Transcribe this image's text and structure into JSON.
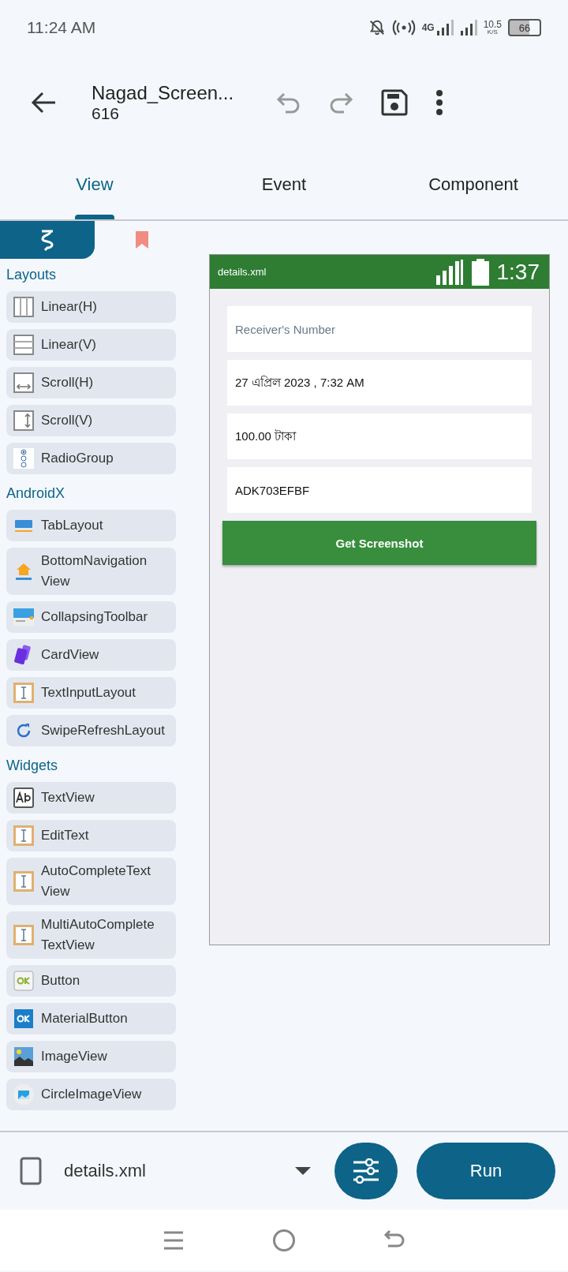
{
  "status_bar": {
    "time": "11:24 AM",
    "network": "4G",
    "speed": "10.5",
    "speed_unit": "K/S",
    "battery": "66"
  },
  "toolbar": {
    "title": "Nagad_Screen...",
    "subtitle": "616"
  },
  "tabs": [
    {
      "label": "View",
      "selected": true
    },
    {
      "label": "Event",
      "selected": false
    },
    {
      "label": "Component",
      "selected": false
    }
  ],
  "palette_tabs": [
    {
      "kind": "widgets",
      "selected": true
    },
    {
      "kind": "bookmarks",
      "selected": false
    }
  ],
  "palette": [
    {
      "title": "Layouts",
      "items": [
        {
          "label": "Linear(H)",
          "kind": "linear-h"
        },
        {
          "label": "Linear(V)",
          "kind": "linear-v"
        },
        {
          "label": "Scroll(H)",
          "kind": "scroll-h"
        },
        {
          "label": "Scroll(V)",
          "kind": "scroll-v"
        },
        {
          "label": "RadioGroup",
          "kind": "radio"
        }
      ]
    },
    {
      "title": "AndroidX",
      "items": [
        {
          "label": "TabLayout",
          "kind": "tab"
        },
        {
          "label": "BottomNavigation View",
          "kind": "bottom-nav"
        },
        {
          "label": "CollapsingToolbar",
          "kind": "toolbar"
        },
        {
          "label": "CardView",
          "kind": "card"
        },
        {
          "label": "TextInputLayout",
          "kind": "text-input"
        },
        {
          "label": "SwipeRefreshLayout",
          "kind": "refresh"
        }
      ]
    },
    {
      "title": "Widgets",
      "items": [
        {
          "label": "TextView",
          "kind": "text-view"
        },
        {
          "label": "EditText",
          "kind": "text-input"
        },
        {
          "label": "AutoCompleteText View",
          "kind": "text-input"
        },
        {
          "label": "MultiAutoComplete TextView",
          "kind": "text-input"
        },
        {
          "label": "Button",
          "kind": "button"
        },
        {
          "label": "MaterialButton",
          "kind": "material-button"
        },
        {
          "label": "ImageView",
          "kind": "image"
        },
        {
          "label": "CircleImageView",
          "kind": "circle-image"
        }
      ]
    }
  ],
  "preview": {
    "title": "details.xml",
    "clock": "1:37",
    "fields": [
      {
        "placeholder": "Receiver's Number"
      },
      {
        "value": "27 এপ্রিল 2023 , 7:32 AM"
      },
      {
        "value": "100.00 টাকা"
      },
      {
        "value": "ADK703EFBF"
      }
    ],
    "button": "Get Screenshot"
  },
  "bottom_bar": {
    "file": "details.xml",
    "run": "Run"
  }
}
